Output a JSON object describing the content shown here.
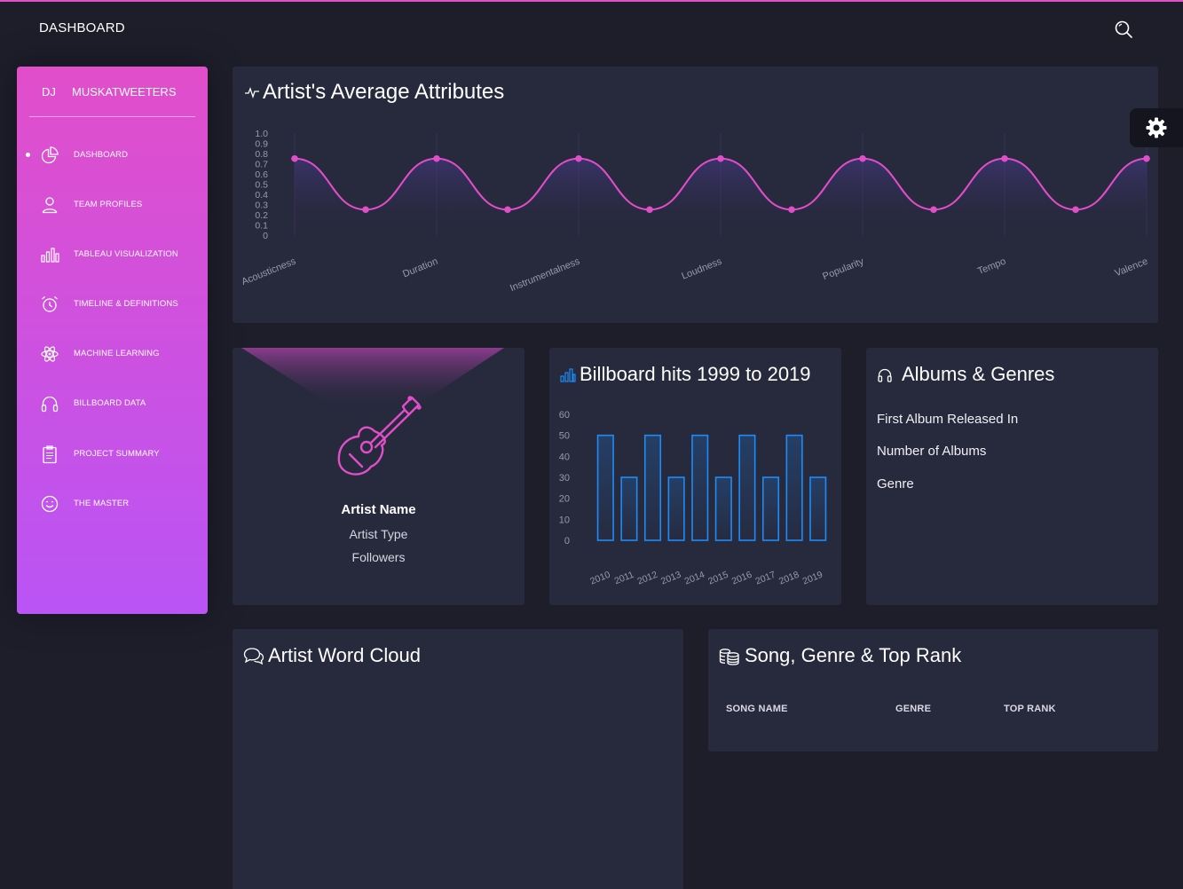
{
  "navbar": {
    "title": "DASHBOARD"
  },
  "sidebar": {
    "brand_short": "DJ",
    "brand_name": "MUSKATWEETERS",
    "items": [
      {
        "label": "DASHBOARD",
        "icon": "pie-chart-icon",
        "active": true
      },
      {
        "label": "TEAM PROFILES",
        "icon": "user-icon"
      },
      {
        "label": "TABLEAU VISUALIZATION",
        "icon": "bar-chart-icon"
      },
      {
        "label": "TIMELINE & DEFINITIONS",
        "icon": "alarm-clock-icon"
      },
      {
        "label": "MACHINE LEARNING",
        "icon": "atom-icon"
      },
      {
        "label": "BILLBOARD DATA",
        "icon": "headphones-icon"
      },
      {
        "label": "PROJECT SUMMARY",
        "icon": "clipboard-icon"
      },
      {
        "label": "THE MASTER",
        "icon": "smiley-icon"
      }
    ]
  },
  "colors": {
    "accent": "#e14eca",
    "accent2": "#ba54f5",
    "bar_blue": "#1d8cf8",
    "card": "#27293d",
    "background": "#1e1e2b"
  },
  "attributes_card": {
    "title": "Artist's Average Attributes"
  },
  "artist_card": {
    "name": "Artist Name",
    "type": "Artist Type",
    "followers": "Followers"
  },
  "billboard_card": {
    "title": "Billboard hits 1999 to 2019"
  },
  "albums_card": {
    "title": "Albums & Genres",
    "lines": [
      "First Album Released In",
      "Number of Albums",
      "Genre"
    ]
  },
  "wordcloud_card": {
    "title": "Artist Word Cloud"
  },
  "song_card": {
    "title": "Song, Genre & Top Rank",
    "columns": [
      "SONG NAME",
      "GENRE",
      "TOP RANK"
    ]
  },
  "chart_data": [
    {
      "type": "line",
      "title": "Artist's Average Attributes",
      "categories": [
        "Acousticness",
        "Duration",
        "Instrumentalness",
        "Loudness",
        "Popularity",
        "Tempo",
        "Valence"
      ],
      "x": [
        0,
        0.5,
        1,
        1.5,
        2,
        2.5,
        3,
        3.5,
        4,
        4.5,
        5,
        5.5,
        6
      ],
      "values": [
        0.75,
        0.25,
        0.75,
        0.25,
        0.75,
        0.25,
        0.75,
        0.25,
        0.75,
        0.25,
        0.75,
        0.25,
        0.75
      ],
      "ylim": [
        0,
        1.0
      ],
      "yticks": [
        "1.0",
        "0.9",
        "0.8",
        "0.7",
        "0.6",
        "0.5",
        "0.4",
        "0.3",
        "0.2",
        "0.1",
        "0"
      ],
      "grid": "vertical",
      "color": "#e14eca"
    },
    {
      "type": "bar",
      "title": "Billboard hits 1999 to 2019",
      "categories": [
        "2010",
        "2011",
        "2012",
        "2013",
        "2014",
        "2015",
        "2016",
        "2017",
        "2018",
        "2019"
      ],
      "values": [
        50,
        30,
        50,
        30,
        50,
        30,
        50,
        30,
        50,
        30
      ],
      "ylim": [
        0,
        60
      ],
      "yticks": [
        "60",
        "50",
        "40",
        "30",
        "20",
        "10",
        "0"
      ],
      "color": "#1d8cf8"
    }
  ]
}
